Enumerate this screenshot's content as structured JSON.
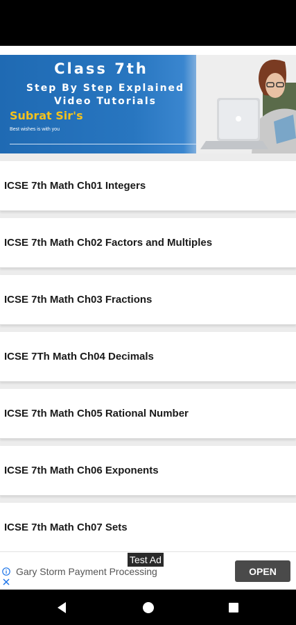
{
  "banner": {
    "title": "Class 7th",
    "subtitle_line1": "Step By Step Explained",
    "subtitle_line2": "Video Tutorials",
    "brand": "Subrat Sir's",
    "tagline": "Best wishes is with you"
  },
  "chapters": [
    {
      "label": "ICSE 7th Math Ch01 Integers"
    },
    {
      "label": "ICSE 7th Math Ch02 Factors and Multiples"
    },
    {
      "label": "ICSE 7th Math Ch03 Fractions"
    },
    {
      "label": "ICSE 7Th Math Ch04 Decimals"
    },
    {
      "label": "ICSE 7th Math Ch05 Rational Number"
    },
    {
      "label": "ICSE 7th Math Ch06 Exponents"
    },
    {
      "label": "ICSE 7th Math Ch07 Sets"
    }
  ],
  "ad": {
    "badge": "Test Ad",
    "text": "Gary Storm Payment Processing",
    "open_label": "OPEN",
    "info_icon": "info-icon",
    "close_icon": "close-icon"
  },
  "nav": {
    "back_icon": "back-icon",
    "home_icon": "home-icon",
    "recent_icon": "recent-apps-icon"
  },
  "colors": {
    "banner_blue": "#2876c0",
    "brand_yellow": "#f4c21c",
    "ad_button": "#4a4a4a",
    "ad_info_blue": "#1a73e8"
  }
}
